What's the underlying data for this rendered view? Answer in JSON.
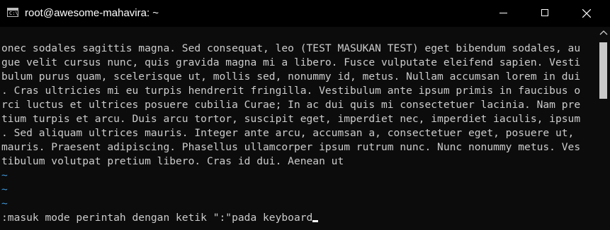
{
  "window": {
    "title": "root@awesome-mahavira: ~",
    "icon": "terminal-icon",
    "icon_glyph": "C:\\"
  },
  "controls": {
    "minimize": "minimize-icon",
    "maximize": "maximize-icon",
    "close": "close-icon"
  },
  "terminal": {
    "lines": [
      "onec sodales sagittis magna. Sed consequat, leo (TEST MASUKAN TEST) eget bibendum sodales, au",
      "gue velit cursus nunc, quis gravida magna mi a libero. Fusce vulputate eleifend sapien. Vesti",
      "bulum purus quam, scelerisque ut, mollis sed, nonummy id, metus. Nullam accumsan lorem in dui",
      ". Cras ultricies mi eu turpis hendrerit fringilla. Vestibulum ante ipsum primis in faucibus o",
      "rci luctus et ultrices posuere cubilia Curae; In ac dui quis mi consectetuer lacinia. Nam pre",
      "tium turpis et arcu. Duis arcu tortor, suscipit eget, imperdiet nec, imperdiet iaculis, ipsum",
      ". Sed aliquam ultrices mauris. Integer ante arcu, accumsan a, consectetuer eget, posuere ut, ",
      "mauris. Praesent adipiscing. Phasellus ullamcorper ipsum rutrum nunc. Nunc nonummy metus. Ves",
      "tibulum volutpat pretium libero. Cras id dui. Aenean ut"
    ],
    "tilde": "~",
    "command_line": ":masuk mode perintah dengan ketik \":\"pada keyboard"
  },
  "colors": {
    "background": "#0c0c0c",
    "text": "#cccccc",
    "tilde": "#3a96dd"
  }
}
